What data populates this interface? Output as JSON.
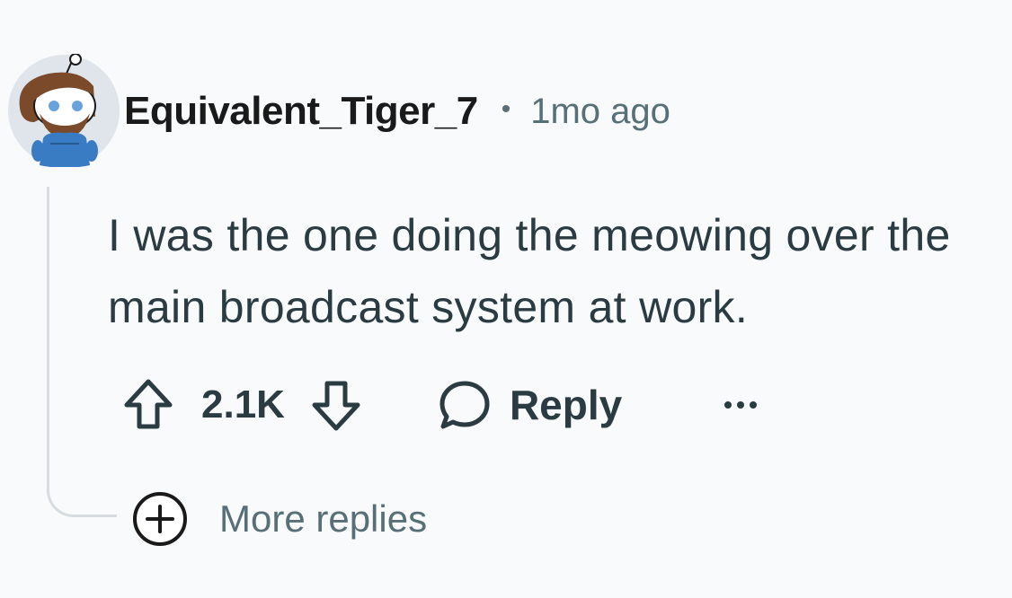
{
  "comment": {
    "username": "Equivalent_Tiger_7",
    "separator": "•",
    "time": "1mo ago",
    "body": "I was the one doing the meowing over the main broadcast system at work.",
    "avatar_icon": "snoo-avatar-icon"
  },
  "actions": {
    "upvote_icon": "upvote-arrow-icon",
    "vote_count": "2.1K",
    "downvote_icon": "downvote-arrow-icon",
    "reply_icon": "speech-bubble-icon",
    "reply_label": "Reply",
    "more_icon": "ellipsis-icon"
  },
  "more_replies": {
    "icon": "plus-circle-icon",
    "label": "More replies"
  },
  "colors": {
    "background": "#f9fafb",
    "text_primary": "#1a1a1b",
    "text_body": "#2a3c42",
    "text_muted": "#576f76",
    "thread_line": "#d7dce0"
  }
}
